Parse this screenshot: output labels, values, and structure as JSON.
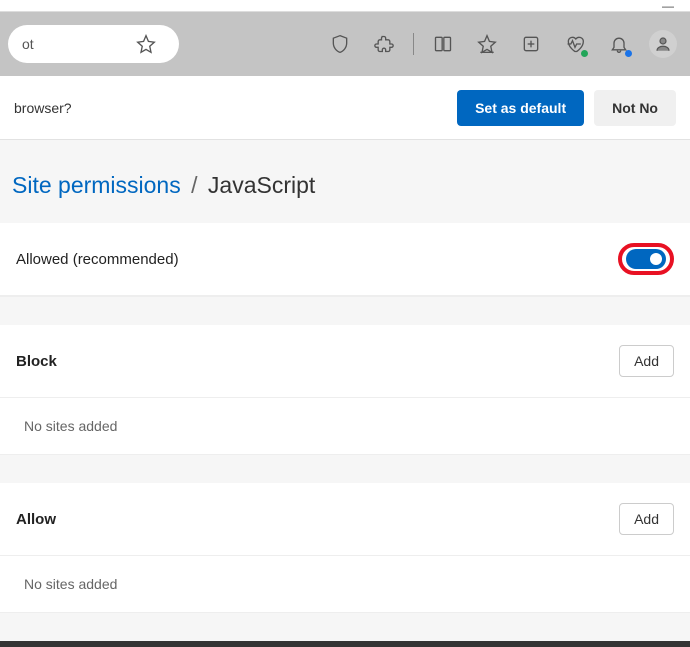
{
  "window": {
    "minimize": "—"
  },
  "toolbar": {
    "url_fragment": "ot"
  },
  "prompt": {
    "question": "browser?",
    "set_default": "Set as default",
    "not_now": "Not No"
  },
  "breadcrumb": {
    "parent": "Site permissions",
    "current": "JavaScript"
  },
  "sections": {
    "allowed": {
      "label": "Allowed (recommended)"
    },
    "block": {
      "label": "Block",
      "add": "Add",
      "empty": "No sites added"
    },
    "allow": {
      "label": "Allow",
      "add": "Add",
      "empty": "No sites added"
    }
  },
  "colors": {
    "primary": "#0067c0",
    "highlight": "#e81123"
  }
}
